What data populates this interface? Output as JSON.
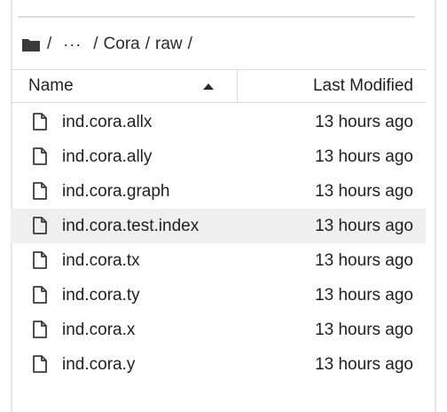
{
  "breadcrumbs": {
    "root_icon": "folder-icon",
    "root_sep": "/",
    "more": "···",
    "sep1": "/",
    "folder1": "Cora",
    "sep2": "/",
    "folder2": "raw",
    "sep3": "/"
  },
  "header": {
    "name_label": "Name",
    "sort_icon": "caret-up-icon",
    "modified_label": "Last Modified"
  },
  "files": [
    {
      "name": "ind.cora.allx",
      "modified": "13 hours ago",
      "icon": "file-icon"
    },
    {
      "name": "ind.cora.ally",
      "modified": "13 hours ago",
      "icon": "file-icon"
    },
    {
      "name": "ind.cora.graph",
      "modified": "13 hours ago",
      "icon": "file-icon"
    },
    {
      "name": "ind.cora.test.index",
      "modified": "13 hours ago",
      "icon": "file-icon",
      "selected": true
    },
    {
      "name": "ind.cora.tx",
      "modified": "13 hours ago",
      "icon": "file-icon"
    },
    {
      "name": "ind.cora.ty",
      "modified": "13 hours ago",
      "icon": "file-icon"
    },
    {
      "name": "ind.cora.x",
      "modified": "13 hours ago",
      "icon": "file-icon"
    },
    {
      "name": "ind.cora.y",
      "modified": "13 hours ago",
      "icon": "file-icon"
    }
  ],
  "colors": {
    "selected_row": "#efefef",
    "border": "#dadada",
    "text": "#1f1f1f"
  }
}
